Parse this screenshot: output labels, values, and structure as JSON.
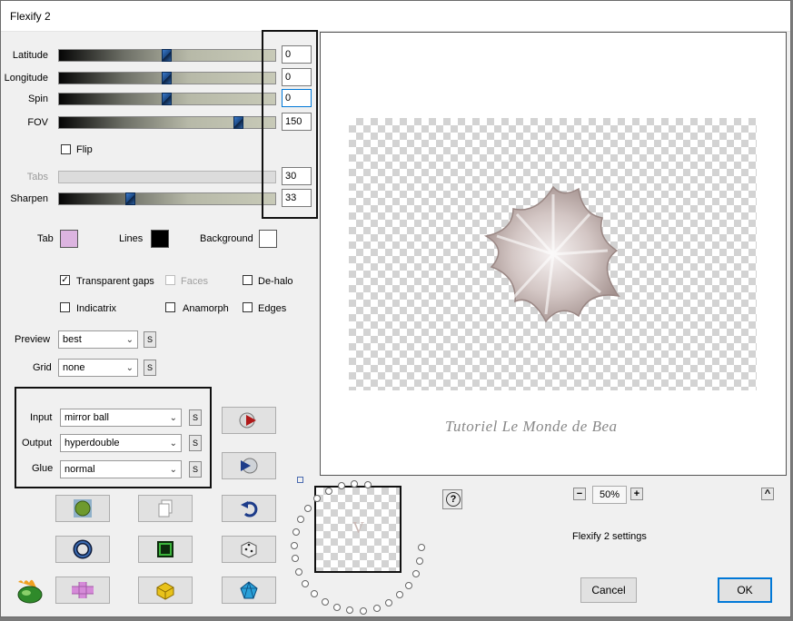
{
  "window": {
    "title": "Flexify 2"
  },
  "sliders": [
    {
      "label": "Latitude",
      "value": "0",
      "fraction": 0.5,
      "enabled": true
    },
    {
      "label": "Longitude",
      "value": "0",
      "fraction": 0.5,
      "enabled": true
    },
    {
      "label": "Spin",
      "value": "0",
      "fraction": 0.5,
      "enabled": true
    },
    {
      "label": "FOV",
      "value": "150",
      "fraction": 0.83,
      "enabled": true
    },
    {
      "label": "Tabs",
      "value": "30",
      "fraction": 0.0,
      "enabled": false
    },
    {
      "label": "Sharpen",
      "value": "33",
      "fraction": 0.33,
      "enabled": true
    }
  ],
  "flip": {
    "label": "Flip",
    "checked": false
  },
  "colors": {
    "tab": {
      "label": "Tab",
      "color": "#dcb4e0"
    },
    "lines": {
      "label": "Lines",
      "color": "#000000"
    },
    "background": {
      "label": "Background",
      "color": "#ffffff"
    }
  },
  "options": {
    "transparent_gaps": {
      "label": "Transparent gaps",
      "checked": true
    },
    "faces": {
      "label": "Faces",
      "checked": false
    },
    "de_halo": {
      "label": "De-halo",
      "checked": false
    },
    "indicatrix": {
      "label": "Indicatrix",
      "checked": false
    },
    "anamorph": {
      "label": "Anamorph",
      "checked": false
    },
    "edges": {
      "label": "Edges",
      "checked": false
    }
  },
  "preview": {
    "label": "Preview",
    "value": "best",
    "s": "S"
  },
  "grid": {
    "label": "Grid",
    "value": "none",
    "s": "S"
  },
  "projection": {
    "input": {
      "label": "Input",
      "value": "mirror ball",
      "s": "S"
    },
    "output": {
      "label": "Output",
      "value": "hyperdouble",
      "s": "S"
    },
    "glue": {
      "label": "Glue",
      "value": "normal",
      "s": "S"
    }
  },
  "preview_image": {
    "watermark": "Tutoriel Le Monde de Bea",
    "thumbnail_letter": "V"
  },
  "zoom": {
    "level": "50%",
    "minus": "−",
    "plus": "+"
  },
  "help": {
    "label": "?"
  },
  "collapse": {
    "label": "^"
  },
  "settings_name": "Flexify 2 settings",
  "buttons": {
    "cancel": "Cancel",
    "ok": "OK"
  },
  "icons": [
    "render-arrow-icon",
    "play-forward-icon",
    "green-ball-icon",
    "copy-pages-icon",
    "undo-arrow-icon",
    "blue-ring-icon",
    "green-square-icon",
    "dice-icon",
    "flaming-logo-icon",
    "pink-plus-icon",
    "yellow-cube-icon",
    "blue-gem-icon"
  ]
}
